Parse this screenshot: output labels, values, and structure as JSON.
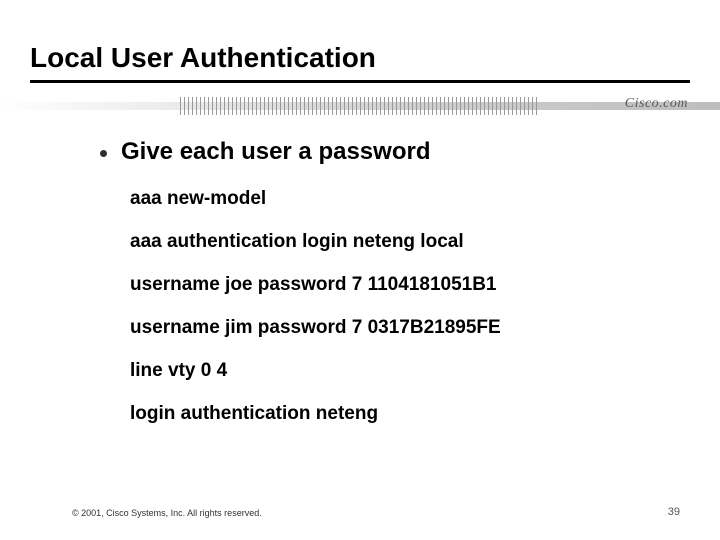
{
  "title": "Local User Authentication",
  "brand": "Cisco.com",
  "bullet": "Give each user a password",
  "config": {
    "l1": "aaa new-model",
    "l2": "aaa authentication login neteng local",
    "l3": "username joe password 7 1104181051B1",
    "l4": "username jim password 7 0317B21895FE",
    "l5": "line vty 0 4",
    "l6": "login authentication neteng"
  },
  "footer": {
    "copyright": "© 2001, Cisco Systems, Inc. All rights reserved.",
    "page": "39"
  }
}
